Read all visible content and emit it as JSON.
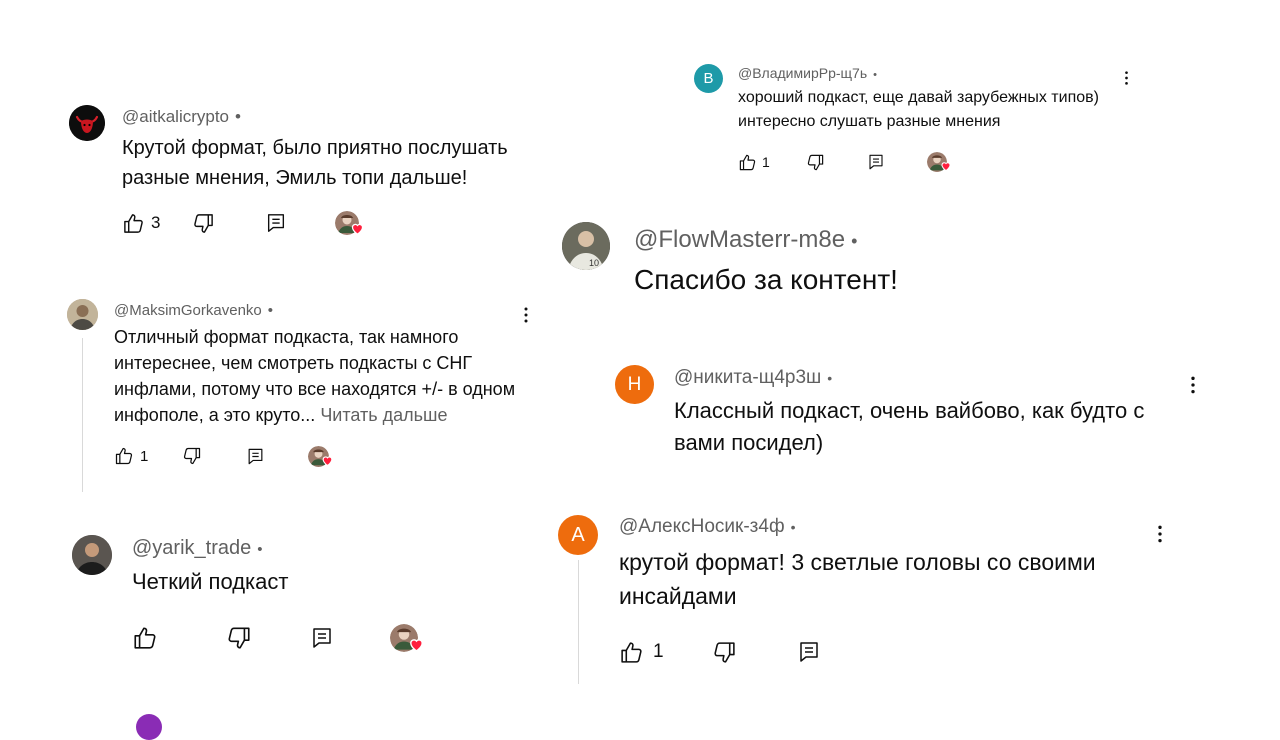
{
  "comments": [
    {
      "handle": "@aitkalicrypto",
      "dot": "•",
      "text": "Крутой формат, было приятно послушать разные мнения, Эмиль топи дальше!",
      "likes": "3"
    },
    {
      "handle": "@MaksimGorkavenko",
      "dot": "•",
      "text": "Отличный формат подкаста, так намного интереснее, чем смотреть подкасты с СНГ инфлами, потому что все находятся +/- в одном инфополе, а это круто...",
      "more": "Читать дальше",
      "likes": "1"
    },
    {
      "handle": "@yarik_trade",
      "dot": "•",
      "text": "Четкий подкаст",
      "likes": ""
    },
    {
      "avatar_letter": "В",
      "handle": "@ВладимирРр-щ7ь",
      "dot": "•",
      "text": "хороший подкаст, еще давай зарубежных типов) интересно слушать разные мнения",
      "likes": "1"
    },
    {
      "handle": "@FlowMasterr-m8e",
      "dot": "•",
      "text": "Спасибо за контент!"
    },
    {
      "avatar_letter": "Н",
      "handle": "@никита-щ4р3ш",
      "dot": "•",
      "text": "Классный подкаст, очень вайбово, как будто с вами посидел)"
    },
    {
      "avatar_letter": "А",
      "handle": "@АлексНосик-з4ф",
      "dot": "•",
      "text": "крутой формат! 3 светлые головы со своими инсайдами",
      "likes": "1"
    }
  ],
  "icons": {
    "like": "thumbs-up-icon",
    "dislike": "thumbs-down-icon",
    "reply": "reply-icon",
    "menu": "more-vert-icon",
    "creator_heart": "creator-heart-icon"
  },
  "colors": {
    "text": "#0f0f0f",
    "secondary": "#606060",
    "heart": "#ff1f3d",
    "avatar_teal": "#1e9aa8",
    "avatar_orange": "#ee6c0d"
  }
}
